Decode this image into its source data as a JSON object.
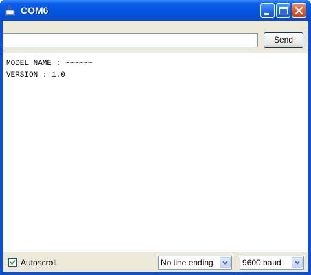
{
  "window": {
    "title": "COM6",
    "icons": {
      "app": "java-cup-icon",
      "minimize": "minimize-icon",
      "maximize": "maximize-icon",
      "close": "close-icon"
    },
    "colors": {
      "titlebar": "#0457e1",
      "close_button": "#d9532b",
      "client_bg": "#ece9d8"
    }
  },
  "input": {
    "value": "",
    "send_label": "Send"
  },
  "output": {
    "lines": [
      "MODEL NAME : ~~~~~~",
      "VERSION : 1.0"
    ]
  },
  "status": {
    "autoscroll_label": "Autoscroll",
    "autoscroll_checked": true,
    "line_ending": "No line ending",
    "baud": "9600 baud"
  }
}
